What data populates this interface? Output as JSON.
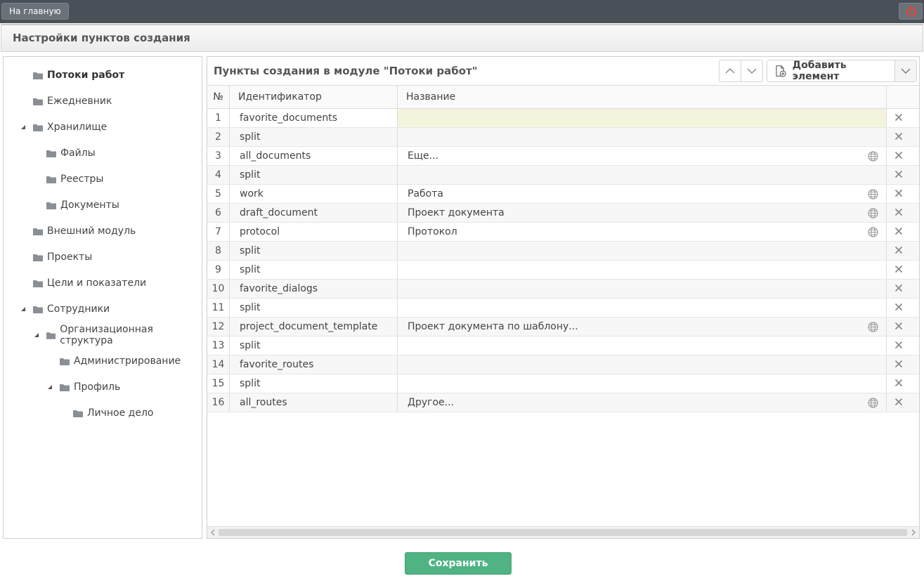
{
  "topbar": {
    "home_label": "На главную",
    "power_icon": "power-icon"
  },
  "header": {
    "title": "Настройки пунктов создания"
  },
  "tree": {
    "items": [
      {
        "label": "Потоки работ",
        "bold": true,
        "level": 0,
        "expanded": null
      },
      {
        "label": "Ежедневник",
        "level": 0,
        "expanded": null
      },
      {
        "label": "Хранилище",
        "level": 0,
        "expanded": true
      },
      {
        "label": "Файлы",
        "level": 1,
        "expanded": null
      },
      {
        "label": "Реестры",
        "level": 1,
        "expanded": null
      },
      {
        "label": "Документы",
        "level": 1,
        "expanded": null
      },
      {
        "label": "Внешний модуль",
        "level": 0,
        "expanded": null
      },
      {
        "label": "Проекты",
        "level": 0,
        "expanded": null
      },
      {
        "label": "Цели и показатели",
        "level": 0,
        "expanded": null
      },
      {
        "label": "Сотрудники",
        "level": 0,
        "expanded": true
      },
      {
        "label": "Организационная структура",
        "level": 1,
        "expanded": true
      },
      {
        "label": "Администрирование",
        "level": 2,
        "expanded": null
      },
      {
        "label": "Профиль",
        "level": 2,
        "expanded": true
      },
      {
        "label": "Личное дело",
        "level": 3,
        "expanded": null
      }
    ]
  },
  "panel": {
    "title": "Пункты создания в модуле \"Потоки работ\"",
    "add_label": "Добавить элемент",
    "columns": {
      "num": "№",
      "id": "Идентификатор",
      "name": "Название"
    },
    "rows": [
      {
        "num": "1",
        "id": "favorite_documents",
        "name": "",
        "globe": false,
        "active": true
      },
      {
        "num": "2",
        "id": "split",
        "name": "",
        "globe": false
      },
      {
        "num": "3",
        "id": "all_documents",
        "name": "Еще...",
        "globe": true
      },
      {
        "num": "4",
        "id": "split",
        "name": "",
        "globe": false
      },
      {
        "num": "5",
        "id": "work",
        "name": "Работа",
        "globe": true
      },
      {
        "num": "6",
        "id": "draft_document",
        "name": "Проект документа",
        "globe": true
      },
      {
        "num": "7",
        "id": "protocol",
        "name": "Протокол",
        "globe": true
      },
      {
        "num": "8",
        "id": "split",
        "name": "",
        "globe": false
      },
      {
        "num": "9",
        "id": "split",
        "name": "",
        "globe": false
      },
      {
        "num": "10",
        "id": "favorite_dialogs",
        "name": "",
        "globe": false
      },
      {
        "num": "11",
        "id": "split",
        "name": "",
        "globe": false
      },
      {
        "num": "12",
        "id": "project_document_template",
        "name": "Проект документа по шаблону...",
        "globe": true
      },
      {
        "num": "13",
        "id": "split",
        "name": "",
        "globe": false
      },
      {
        "num": "14",
        "id": "favorite_routes",
        "name": "",
        "globe": false
      },
      {
        "num": "15",
        "id": "split",
        "name": "",
        "globe": false
      },
      {
        "num": "16",
        "id": "all_routes",
        "name": "Другое...",
        "globe": true
      }
    ]
  },
  "footer": {
    "save_label": "Сохранить"
  },
  "colors": {
    "topbar": "#4a5057",
    "save": "#4fb384",
    "power": "#e0473a",
    "active_row": "#f4f4dc"
  }
}
